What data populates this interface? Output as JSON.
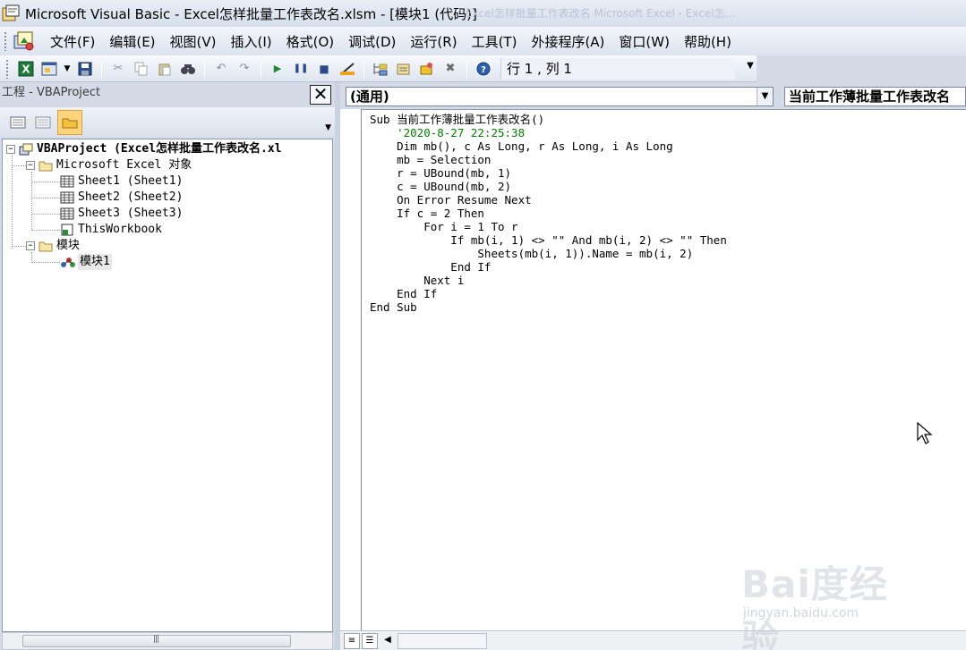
{
  "window": {
    "title": "Microsoft Visual Basic - Excel怎样批量工作表改名.xlsm - [模块1 (代码)]",
    "ghost_tabs": "Excel怎样批量工作表改名    Microsoft Excel - Excel怎..."
  },
  "menu": {
    "items": [
      {
        "label": "文件(F)"
      },
      {
        "label": "编辑(E)"
      },
      {
        "label": "视图(V)"
      },
      {
        "label": "插入(I)"
      },
      {
        "label": "格式(O)"
      },
      {
        "label": "调试(D)"
      },
      {
        "label": "运行(R)"
      },
      {
        "label": "工具(T)"
      },
      {
        "label": "外接程序(A)"
      },
      {
        "label": "窗口(W)"
      },
      {
        "label": "帮助(H)"
      }
    ]
  },
  "toolbar": {
    "position_status": "行 1 , 列 1"
  },
  "project": {
    "title": "工程 - VBAProject",
    "close_glyph": "✕",
    "root": "VBAProject (Excel怎样批量工作表改名.xl",
    "excel_objects_folder": "Microsoft Excel 对象",
    "sheets": [
      "Sheet1 (Sheet1)",
      "Sheet2 (Sheet2)",
      "Sheet3 (Sheet3)",
      "ThisWorkbook"
    ],
    "modules_folder": "模块",
    "module": "模块1"
  },
  "code_window": {
    "object_combo": "(通用)",
    "procedure_combo": "当前工作薄批量工作表改名",
    "lines": [
      {
        "text": "Sub 当前工作薄批量工作表改名()",
        "type": "kw"
      },
      {
        "text": "    '2020-8-27 22:25:38",
        "type": "comment"
      },
      {
        "text": "    Dim mb(), c As Long, r As Long, i As Long",
        "type": "kw"
      },
      {
        "text": "    mb = Selection",
        "type": "kw"
      },
      {
        "text": "    r = UBound(mb, 1)",
        "type": "kw"
      },
      {
        "text": "    c = UBound(mb, 2)",
        "type": "kw"
      },
      {
        "text": "    On Error Resume Next",
        "type": "kw"
      },
      {
        "text": "    If c = 2 Then",
        "type": "kw"
      },
      {
        "text": "        For i = 1 To r",
        "type": "kw"
      },
      {
        "text": "            If mb(i, 1) <> \"\" And mb(i, 2) <> \"\" Then",
        "type": "kw"
      },
      {
        "text": "                Sheets(mb(i, 1)).Name = mb(i, 2)",
        "type": "kw"
      },
      {
        "text": "            End If",
        "type": "kw"
      },
      {
        "text": "        Next i",
        "type": "kw"
      },
      {
        "text": "    End If",
        "type": "kw"
      },
      {
        "text": "End Sub",
        "type": "kw"
      }
    ]
  },
  "watermark": {
    "logo": "Bai度经验",
    "url": "jingyan.baidu.com"
  },
  "colors": {
    "comment": "#008000",
    "panel_bg": "#d4dbe7",
    "selected_tool": "#ffd47a"
  },
  "icons": [
    "vba-app-icon",
    "excel-icon",
    "userform-icon",
    "save-icon",
    "cut-icon",
    "copy-icon",
    "paste-icon",
    "find-icon",
    "undo-icon",
    "redo-icon",
    "run-icon",
    "pause-icon",
    "reset-icon",
    "design-mode-icon",
    "project-explorer-icon",
    "properties-icon",
    "object-browser-icon",
    "toolbox-icon",
    "help-icon",
    "view-code-icon",
    "view-object-icon",
    "toggle-folders-icon",
    "worksheet-icon",
    "workbook-icon",
    "module-icon",
    "folder-icon"
  ]
}
